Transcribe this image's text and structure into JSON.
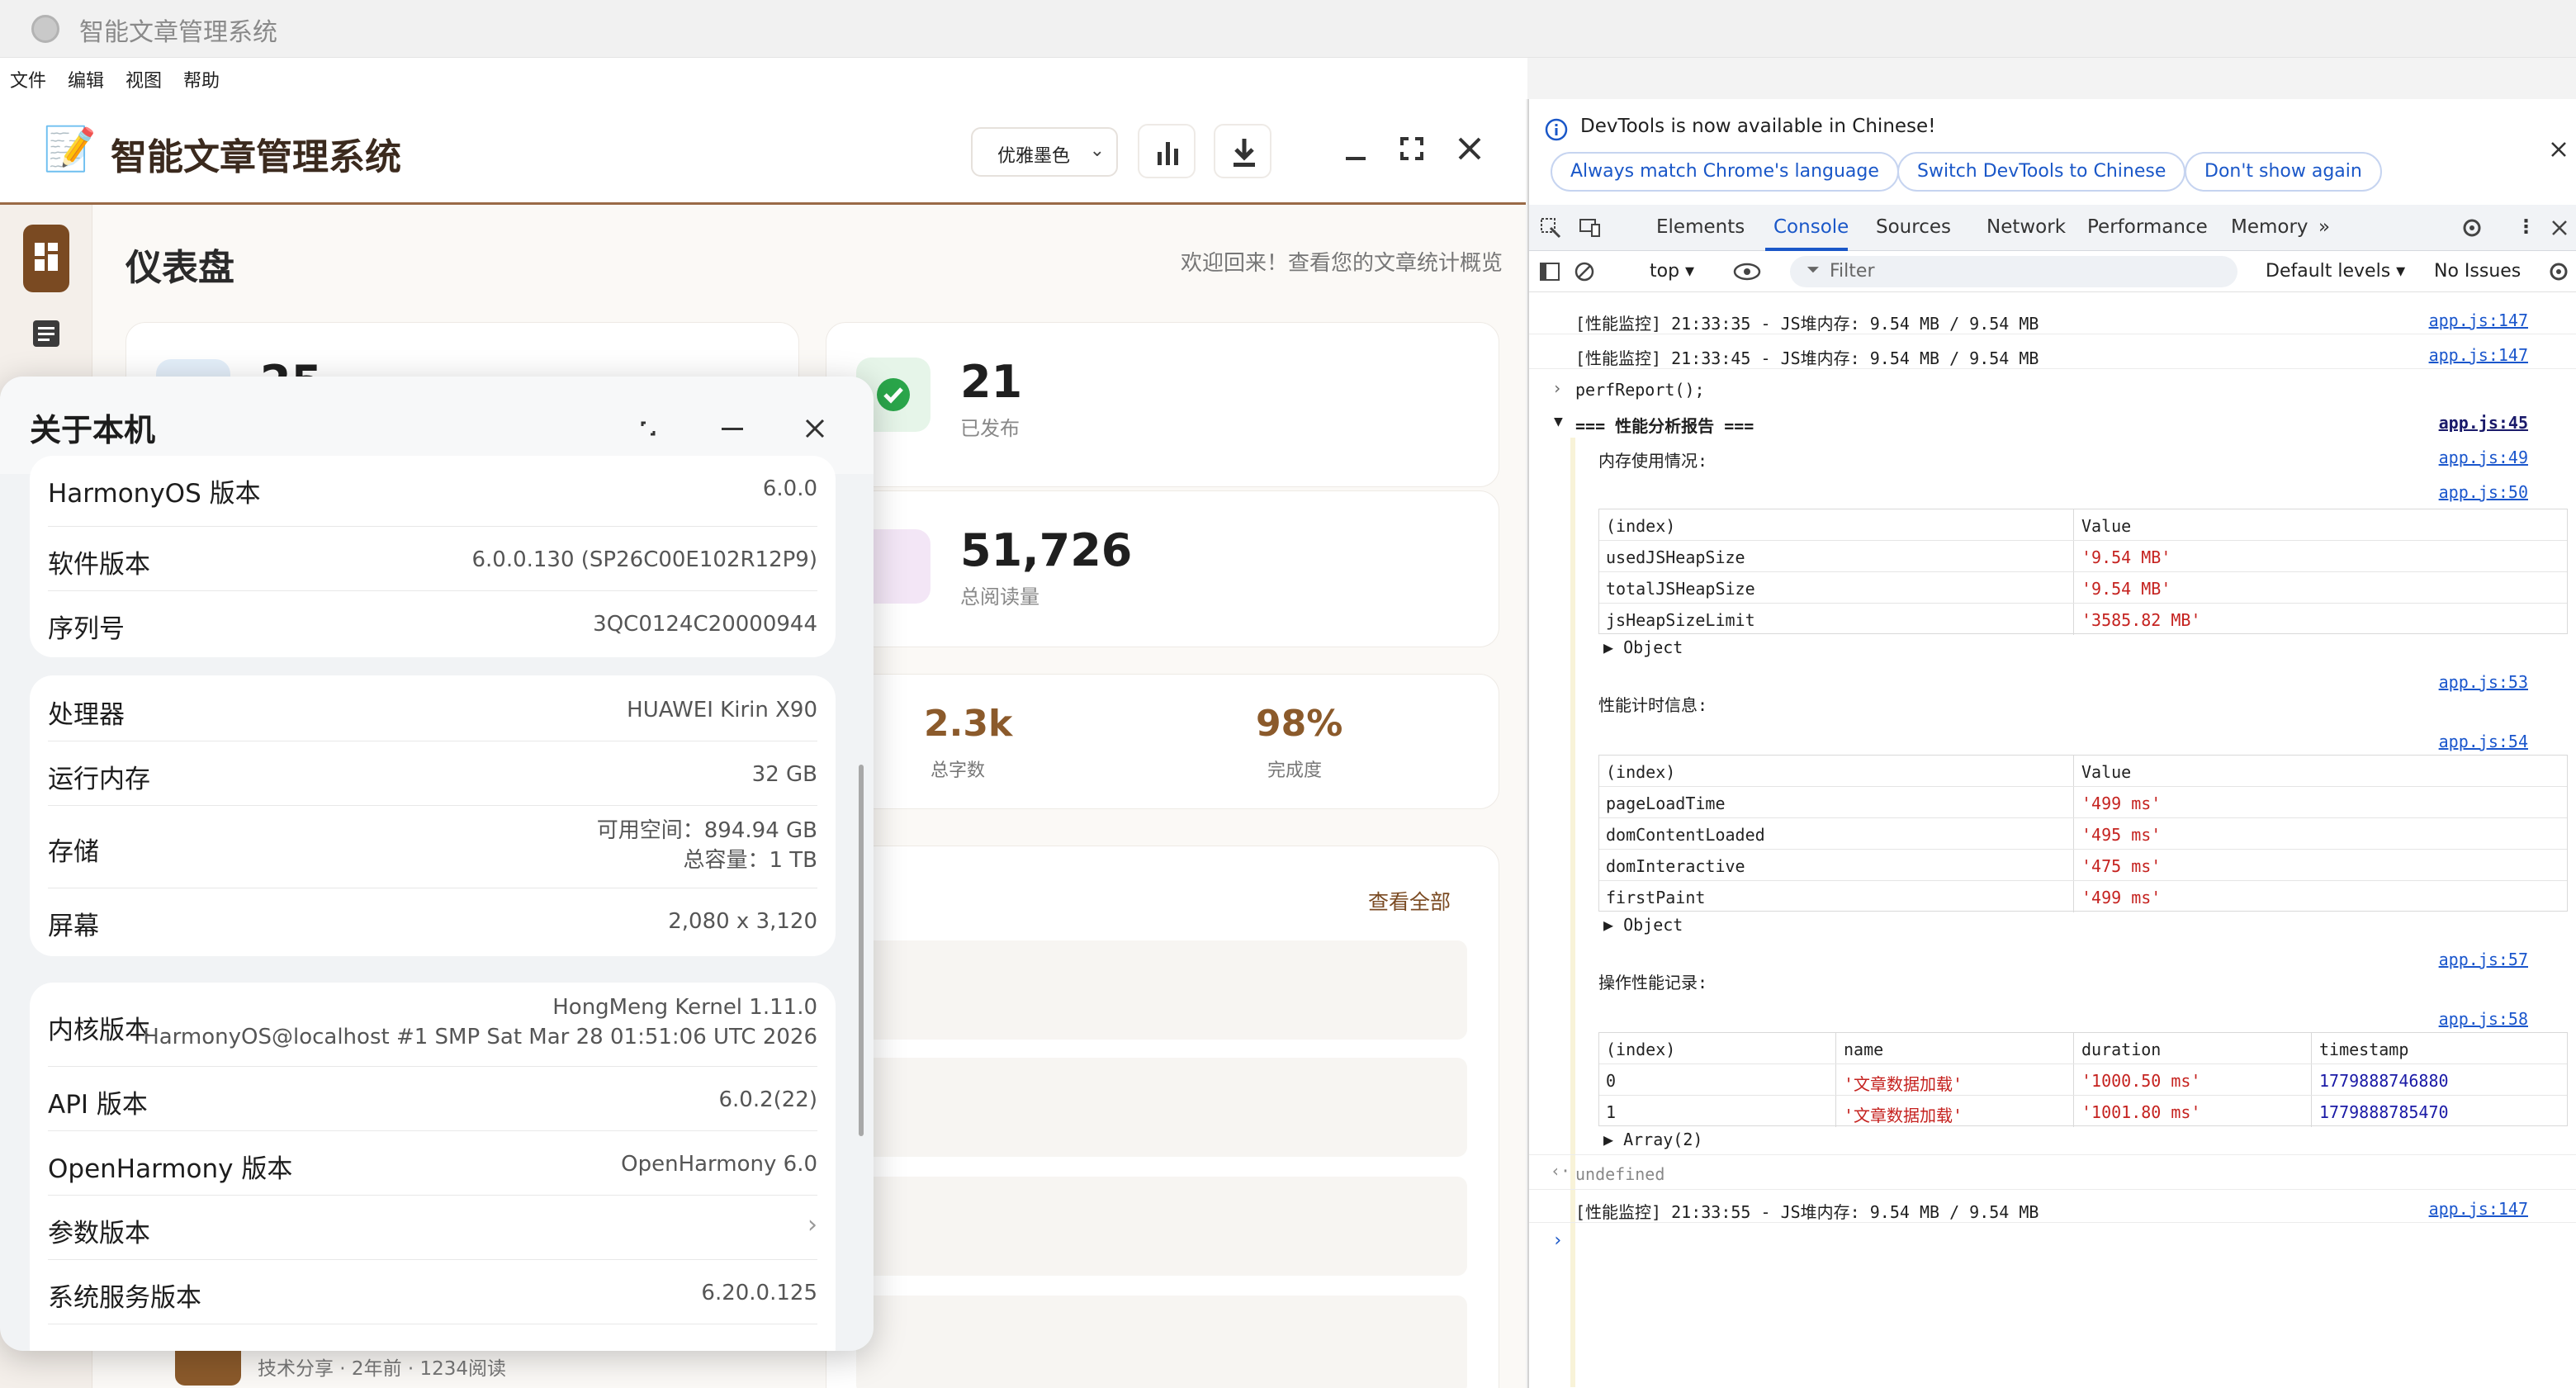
{
  "window": {
    "title": "智能文章管理系统"
  },
  "menu": [
    "文件",
    "编辑",
    "视图",
    "帮助"
  ],
  "app": {
    "emoji": "📝",
    "title": "智能文章管理系统",
    "theme_select": "优雅墨色",
    "dashboard_title": "仪表盘",
    "dashboard_subtitle": "欢迎回来！查看您的文章统计概览",
    "stats": {
      "total_partial": "25",
      "published": {
        "value": "21",
        "label": "已发布"
      },
      "reads": {
        "value": "51,726",
        "label": "总阅读量"
      },
      "words": {
        "value": "2.3k",
        "label": "总字数"
      },
      "completion": {
        "value": "98%",
        "label": "完成度"
      }
    },
    "view_all": "查看全部",
    "article_meta": "技术分享 · 2年前 · 1234阅读",
    "colors": {
      "accent": "#8b5a2b",
      "brand_brown": "#7a4a22"
    }
  },
  "about": {
    "title": "关于本机",
    "group1": [
      {
        "k": "HarmonyOS 版本",
        "v": "6.0.0"
      },
      {
        "k": "软件版本",
        "v": "6.0.0.130 (SP26C00E102R12P9)"
      },
      {
        "k": "序列号",
        "v": "3QC0124C20000944"
      }
    ],
    "group2": [
      {
        "k": "处理器",
        "v": "HUAWEI Kirin X90"
      },
      {
        "k": "运行内存",
        "v": "32 GB"
      },
      {
        "k": "存储",
        "v1": "可用空间：894.94 GB",
        "v2": "总容量：1 TB"
      },
      {
        "k": "屏幕",
        "v": "2,080 x 3,120"
      }
    ],
    "group3": [
      {
        "k": "内核版本",
        "v1": "HongMeng Kernel 1.11.0",
        "v2": "HarmonyOS@localhost #1 SMP Sat Mar 28 01:51:06 UTC 2026"
      },
      {
        "k": "API 版本",
        "v": "6.0.2(22)"
      },
      {
        "k": "OpenHarmony 版本",
        "v": "OpenHarmony 6.0"
      },
      {
        "k": "参数版本",
        "v": ""
      },
      {
        "k": "系统服务版本",
        "v": "6.20.0.125"
      }
    ]
  },
  "devtools": {
    "info": "DevTools is now available in Chinese!",
    "pills": [
      "Always match Chrome's language",
      "Switch DevTools to Chinese",
      "Don't show again"
    ],
    "tabs": [
      "Elements",
      "Console",
      "Sources",
      "Network",
      "Performance",
      "Memory"
    ],
    "context": "top",
    "filter_placeholder": "Filter",
    "levels": "Default levels",
    "issues": "No Issues",
    "logs": {
      "perf1": "[性能监控] 21:33:35 - JS堆内存: 9.54 MB / 9.54 MB",
      "perf2": "[性能监控] 21:33:45 - JS堆内存: 9.54 MB / 9.54 MB",
      "cmd": "perfReport();",
      "report": "=== 性能分析报告 ===",
      "mem_title": "内存使用情况:",
      "timing_title": "性能计时信息:",
      "ops_title": "操作性能记录:",
      "result": "undefined",
      "perf3": "[性能监控] 21:33:55 - JS堆内存: 9.54 MB / 9.54 MB",
      "src147": "app.js:147",
      "src45": "app.js:45",
      "src49": "app.js:49",
      "src50": "app.js:50",
      "src53": "app.js:53",
      "src54": "app.js:54",
      "src57": "app.js:57",
      "src58": "app.js:58"
    },
    "mem_table": {
      "headers": [
        "(index)",
        "Value"
      ],
      "rows": [
        [
          "usedJSHeapSize",
          "'9.54 MB'"
        ],
        [
          "totalJSHeapSize",
          "'9.54 MB'"
        ],
        [
          "jsHeapSizeLimit",
          "'3585.82 MB'"
        ]
      ],
      "footer": "Object"
    },
    "timing_table": {
      "headers": [
        "(index)",
        "Value"
      ],
      "rows": [
        [
          "pageLoadTime",
          "'499 ms'"
        ],
        [
          "domContentLoaded",
          "'495 ms'"
        ],
        [
          "domInteractive",
          "'475 ms'"
        ],
        [
          "firstPaint",
          "'499 ms'"
        ]
      ],
      "footer": "Object"
    },
    "ops_table": {
      "headers": [
        "(index)",
        "name",
        "duration",
        "timestamp"
      ],
      "rows": [
        [
          "0",
          "'文章数据加载'",
          "'1000.50 ms'",
          "1779888746880"
        ],
        [
          "1",
          "'文章数据加载'",
          "'1001.80 ms'",
          "1779888785470"
        ]
      ],
      "footer": "Array(2)"
    }
  }
}
